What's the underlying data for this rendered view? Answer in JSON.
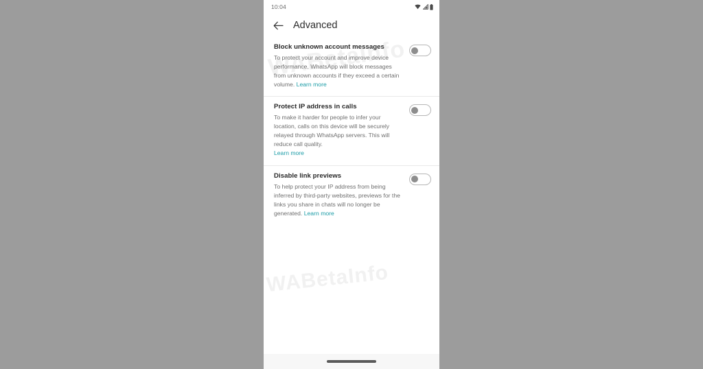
{
  "status_bar": {
    "time": "10:04",
    "icons": [
      {
        "name": "wifi-icon"
      },
      {
        "name": "cellular-signal-icon"
      },
      {
        "name": "battery-icon"
      }
    ]
  },
  "app_bar": {
    "back_icon": "back-arrow-icon",
    "title": "Advanced"
  },
  "watermark": {
    "text": "WABetaInfo",
    "text_low": "WABetaInfo"
  },
  "settings": [
    {
      "id": "block-unknown-account-messages",
      "title": "Block unknown account messages",
      "description": "To protect your account and improve device performance, WhatsApp will block messages from unknown accounts if they exceed a certain volume. ",
      "learn_more": "Learn more",
      "learn_more_inline": true,
      "toggle_state": "off"
    },
    {
      "id": "protect-ip-address-in-calls",
      "title": "Protect IP address in calls",
      "description": "To make it harder for people to infer your location, calls on this device will be securely relayed through WhatsApp servers. This will reduce call quality.",
      "learn_more": "Learn more",
      "learn_more_inline": false,
      "toggle_state": "off"
    },
    {
      "id": "disable-link-previews",
      "title": "Disable link previews",
      "description": "To help protect your IP address from being inferred by third-party websites, previews for the links you share in chats will no longer be generated. ",
      "learn_more": "Learn more",
      "learn_more_inline": true,
      "toggle_state": "off"
    }
  ],
  "nav_bar": {
    "gesture_pill": "home-gesture-pill"
  },
  "colors": {
    "link": "#1a9ba6",
    "page_background": "#9c9c9c",
    "screen_background": "#ffffff",
    "title_text": "#262626",
    "body_text": "#6e6e6e",
    "toggle_track_border": "#b6b6b6",
    "toggle_thumb": "#8d8d8d"
  }
}
